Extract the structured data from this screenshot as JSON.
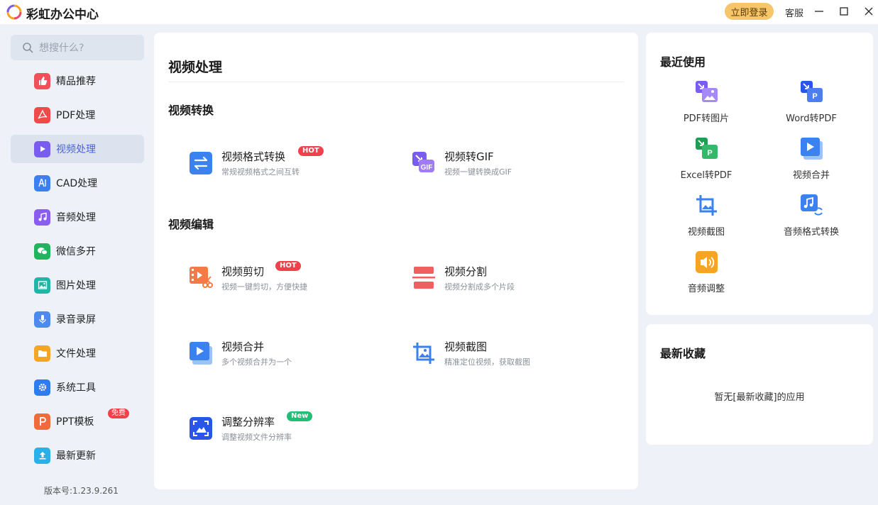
{
  "app": {
    "title": "彩虹办公中心",
    "login_label": "立即登录",
    "service_label": "客服"
  },
  "sidebar": {
    "search_placeholder": "想搜什么?",
    "items": [
      {
        "label": "精品推荐",
        "icon": "thumbs-up-icon",
        "color": "#f0505a"
      },
      {
        "label": "PDF处理",
        "icon": "pdf-icon",
        "color": "#ef4a4a"
      },
      {
        "label": "视频处理",
        "icon": "play-icon",
        "color": "#7a5cf0",
        "active": true
      },
      {
        "label": "CAD处理",
        "icon": "cad-icon",
        "color": "#3b7ff0"
      },
      {
        "label": "音频处理",
        "icon": "music-icon",
        "color": "#8a5cf0"
      },
      {
        "label": "微信多开",
        "icon": "wechat-icon",
        "color": "#22b35e"
      },
      {
        "label": "图片处理",
        "icon": "image-icon",
        "color": "#20b5a6"
      },
      {
        "label": "录音录屏",
        "icon": "microphone-icon",
        "color": "#4d8af0"
      },
      {
        "label": "文件处理",
        "icon": "folder-icon",
        "color": "#f5a524"
      },
      {
        "label": "系统工具",
        "icon": "gear-icon",
        "color": "#2d7cf0"
      },
      {
        "label": "PPT模板",
        "icon": "ppt-icon",
        "color": "#f06a3a",
        "badge": "免费"
      },
      {
        "label": "最新更新",
        "icon": "upload-icon",
        "color": "#29b0e8"
      }
    ],
    "version": "版本号:1.23.9.261"
  },
  "main": {
    "title": "视频处理",
    "sections": [
      {
        "title": "视频转换",
        "tools": [
          {
            "name": "视频格式转换",
            "desc": "常规视频格式之间互转",
            "tag": "HOT",
            "icon": "swap-icon"
          },
          {
            "name": "视频转GIF",
            "desc": "视频一键转换成GIF",
            "icon": "gif-icon"
          }
        ]
      },
      {
        "title": "视频编辑",
        "tools": [
          {
            "name": "视频剪切",
            "desc": "视频一键剪切，方便快捷",
            "tag": "HOT",
            "icon": "video-cut-icon"
          },
          {
            "name": "视频分割",
            "desc": "视频分割成多个片段",
            "icon": "split-icon"
          },
          {
            "name": "视频合并",
            "desc": "多个视频合并为一个",
            "icon": "merge-icon"
          },
          {
            "name": "视频截图",
            "desc": "精准定位视频，获取截图",
            "icon": "crop-icon"
          },
          {
            "name": "调整分辨率",
            "desc": "调整视频文件分辨率",
            "tag": "New",
            "icon": "resolution-icon"
          }
        ]
      }
    ]
  },
  "recent": {
    "title": "最近使用",
    "items": [
      {
        "name": "PDF转图片",
        "icon": "pdf-to-image-icon"
      },
      {
        "name": "Word转PDF",
        "icon": "word-to-pdf-icon"
      },
      {
        "name": "Excel转PDF",
        "icon": "excel-to-pdf-icon"
      },
      {
        "name": "视频合并",
        "icon": "merge-icon"
      },
      {
        "name": "视频截图",
        "icon": "crop-icon"
      },
      {
        "name": "音频格式转换",
        "icon": "audio-convert-icon"
      },
      {
        "name": "音频调整",
        "icon": "volume-icon"
      }
    ]
  },
  "favorites": {
    "title": "最新收藏",
    "empty_text": "暂无[最新收藏]的应用"
  }
}
